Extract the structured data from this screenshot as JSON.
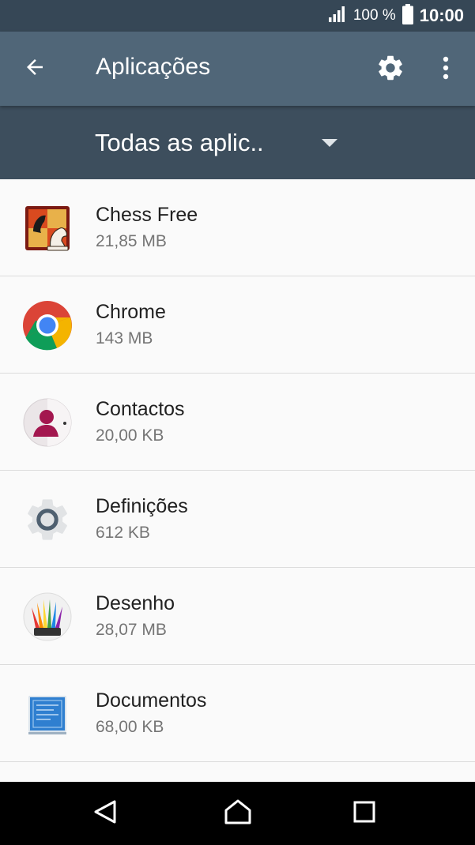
{
  "status_bar": {
    "battery_percent": "100 %",
    "time": "10:00",
    "icons": [
      "signal-icon",
      "battery-icon"
    ]
  },
  "app_bar": {
    "title": "Aplicações",
    "icons": [
      "back-arrow-icon",
      "gear-icon",
      "more-vert-icon"
    ]
  },
  "filter": {
    "selected": "Todas as aplic.."
  },
  "apps": [
    {
      "name": "Chess Free",
      "size": "21,85 MB",
      "icon": "chess-icon"
    },
    {
      "name": "Chrome",
      "size": "143 MB",
      "icon": "chrome-icon"
    },
    {
      "name": "Contactos",
      "size": "20,00 KB",
      "icon": "contacts-icon"
    },
    {
      "name": "Definições",
      "size": "612 KB",
      "icon": "settings-icon"
    },
    {
      "name": "Desenho",
      "size": "28,07 MB",
      "icon": "sketch-icon"
    },
    {
      "name": "Documentos",
      "size": "68,00 KB",
      "icon": "documents-icon"
    }
  ],
  "nav_bar": {
    "icons": [
      "back-triangle-icon",
      "home-icon",
      "recents-icon"
    ]
  },
  "colors": {
    "status_bar": "#364756",
    "app_bar": "#506678",
    "filter_bar": "#3d4e5d",
    "list_background": "#fafafa"
  }
}
